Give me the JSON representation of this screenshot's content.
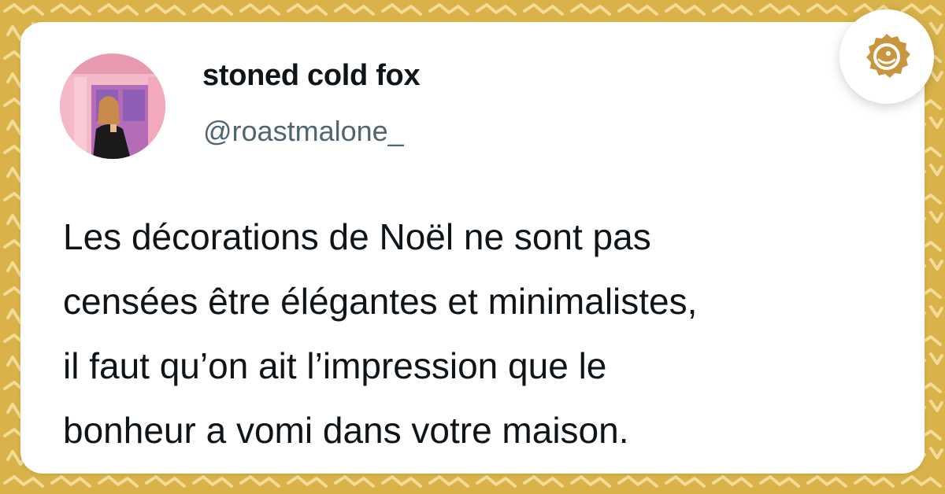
{
  "colors": {
    "background": "#d9b24a",
    "pattern": "#f3dc96",
    "card": "#ffffff",
    "name_text": "#0f1419",
    "handle_text": "#536471",
    "logo": "#c8963e"
  },
  "author": {
    "display_name": "stoned cold fox",
    "handle": "@roastmalone_",
    "avatar_icon": "profile-photo"
  },
  "tweet": {
    "lines": [
      "Les décorations de Noël ne sont pas",
      "censées être élégantes et minimalistes,",
      "il faut qu’on ait l’impression que le",
      "bonheur a vomi dans votre maison."
    ]
  },
  "brand": {
    "icon": "egg-chick-logo-icon"
  }
}
